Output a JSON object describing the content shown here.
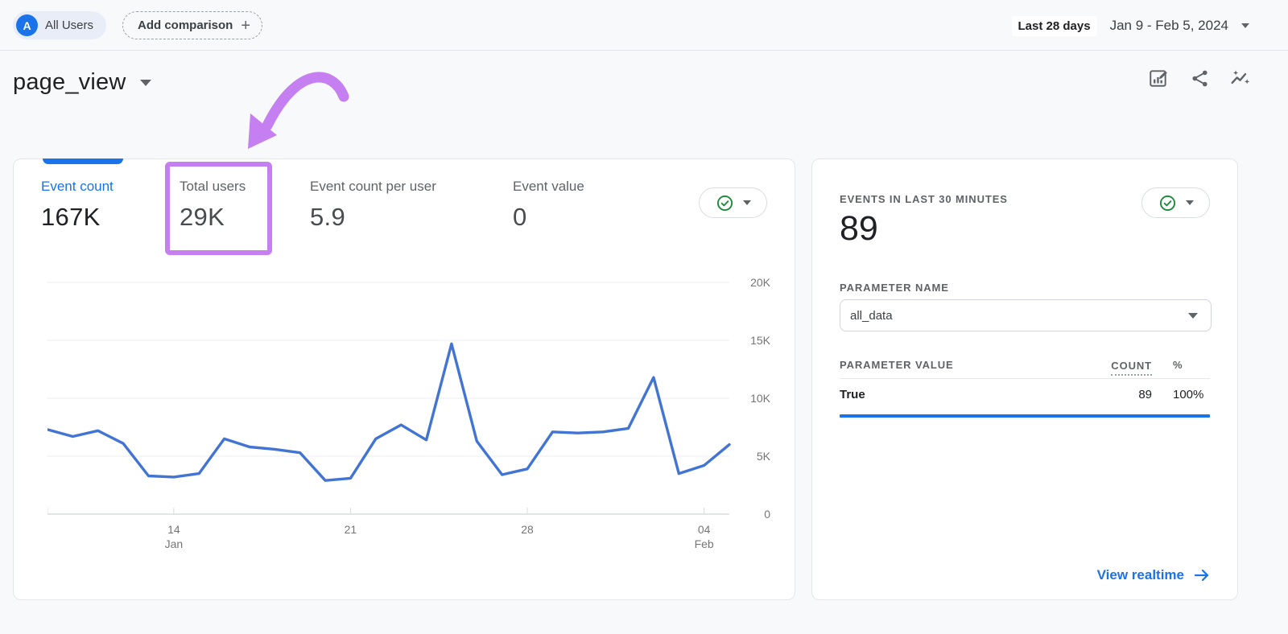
{
  "topbar": {
    "avatar_letter": "A",
    "all_users_label": "All Users",
    "add_comparison_label": "Add comparison",
    "add_comparison_plus": "+",
    "date_preset": "Last 28 days",
    "date_range": "Jan 9 - Feb 5, 2024"
  },
  "page": {
    "title": "page_view"
  },
  "metrics": [
    {
      "label": "Event count",
      "value": "167K"
    },
    {
      "label": "Total users",
      "value": "29K"
    },
    {
      "label": "Event count per user",
      "value": "5.9"
    },
    {
      "label": "Event value",
      "value": "0"
    }
  ],
  "chart_data": {
    "type": "line",
    "categories": [
      "Jan 9",
      "Jan 10",
      "Jan 11",
      "Jan 12",
      "Jan 13",
      "Jan 14",
      "Jan 15",
      "Jan 16",
      "Jan 17",
      "Jan 18",
      "Jan 19",
      "Jan 20",
      "Jan 21",
      "Jan 22",
      "Jan 23",
      "Jan 24",
      "Jan 25",
      "Jan 26",
      "Jan 27",
      "Jan 28",
      "Jan 29",
      "Jan 30",
      "Jan 31",
      "Feb 1",
      "Feb 2",
      "Feb 3",
      "Feb 4",
      "Feb 5"
    ],
    "values": [
      7300,
      6700,
      7200,
      6100,
      3300,
      3200,
      3500,
      6500,
      5800,
      5600,
      5300,
      2900,
      3100,
      6500,
      7700,
      6400,
      14700,
      6300,
      3400,
      3900,
      7100,
      7000,
      7100,
      7400,
      11800,
      3500,
      4200,
      6000
    ],
    "ylim": [
      0,
      20000
    ],
    "yticks": [
      {
        "value": 0,
        "label": "0"
      },
      {
        "value": 5000,
        "label": "5K"
      },
      {
        "value": 10000,
        "label": "10K"
      },
      {
        "value": 15000,
        "label": "15K"
      },
      {
        "value": 20000,
        "label": "20K"
      }
    ],
    "xticks": [
      {
        "index": 5,
        "label": "14",
        "sub": "Jan"
      },
      {
        "index": 12,
        "label": "21"
      },
      {
        "index": 19,
        "label": "28"
      },
      {
        "index": 26,
        "label": "04",
        "sub": "Feb"
      }
    ],
    "grid": true,
    "line_color": "#4274d3"
  },
  "realtime": {
    "header": "EVENTS IN LAST 30 MINUTES",
    "value": "89",
    "parameter_name_label": "PARAMETER NAME",
    "parameter_name_value": "all_data",
    "table": {
      "headers": [
        "PARAMETER VALUE",
        "COUNT",
        "%"
      ],
      "rows": [
        {
          "value": "True",
          "count": "89",
          "percent": "100%"
        }
      ]
    },
    "view_realtime_label": "View realtime"
  },
  "colors": {
    "accent_blue": "#1a73e8",
    "chart_line": "#4274d3",
    "annotation_purple": "#c57ff0",
    "success_green": "#1e8e3e",
    "text_dark": "#202124",
    "text_grey": "#5f6368"
  }
}
